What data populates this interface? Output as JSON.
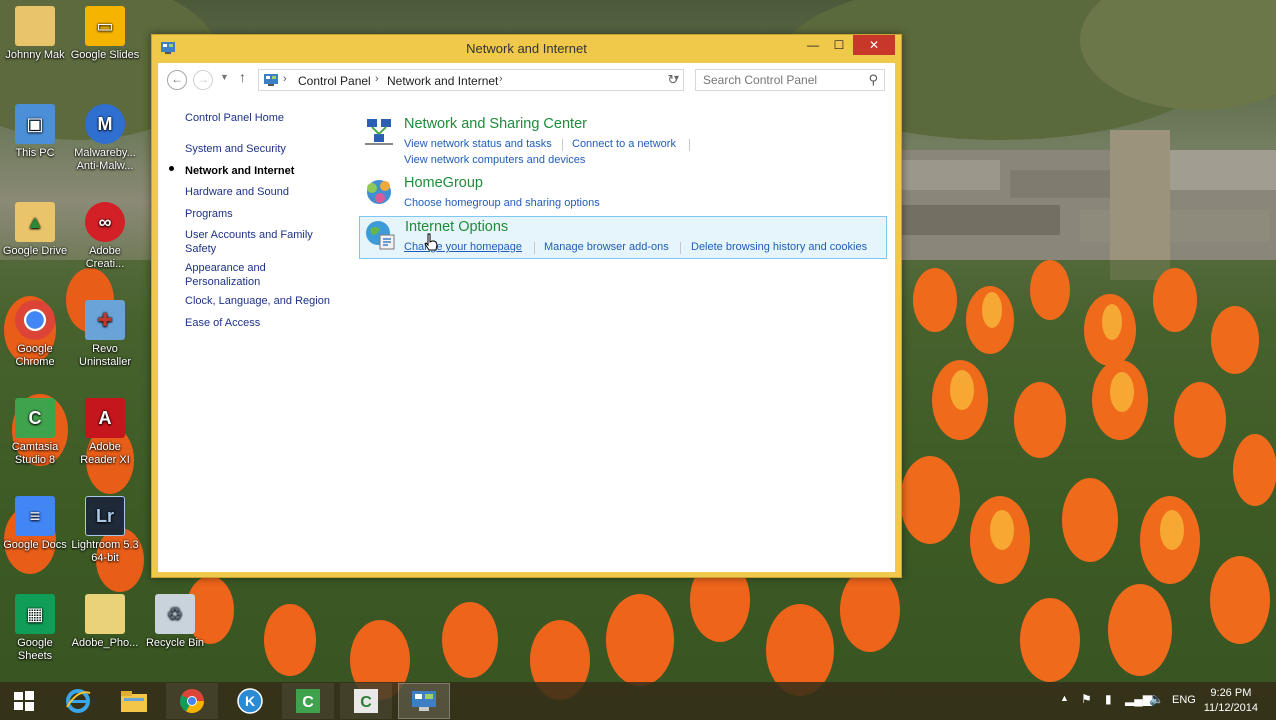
{
  "desktop": {
    "icons": [
      {
        "label": "Johnny Mak"
      },
      {
        "label": "Google Slides"
      },
      {
        "label": "This PC"
      },
      {
        "label": "Malwareby... Anti-Malw..."
      },
      {
        "label": "Google Drive"
      },
      {
        "label": "Adobe Creati..."
      },
      {
        "label": "Google Chrome"
      },
      {
        "label": "Revo Uninstaller"
      },
      {
        "label": "Camtasia Studio 8"
      },
      {
        "label": "Adobe Reader XI"
      },
      {
        "label": "Google Docs"
      },
      {
        "label": "Lightroom 5.3 64-bit"
      },
      {
        "label": "Google Sheets"
      },
      {
        "label": "Adobe_Pho..."
      },
      {
        "label": "Recycle Bin"
      }
    ]
  },
  "window": {
    "title": "Network and Internet",
    "buttons": {
      "minimize": "—",
      "maximize": "☐",
      "close": "✕"
    }
  },
  "address_bar": {
    "breadcrumbs": [
      "Control Panel",
      "Network and Internet"
    ],
    "search_placeholder": "Search Control Panel"
  },
  "sidebar": {
    "items": [
      {
        "label": "Control Panel Home"
      },
      {
        "label": "System and Security"
      },
      {
        "label": "Network and Internet",
        "current": true
      },
      {
        "label": "Hardware and Sound"
      },
      {
        "label": "Programs"
      },
      {
        "label": "User Accounts and Family Safety"
      },
      {
        "label": "Appearance and Personalization"
      },
      {
        "label": "Clock, Language, and Region"
      },
      {
        "label": "Ease of Access"
      }
    ]
  },
  "categories": [
    {
      "title": "Network and Sharing Center",
      "icon": "network-sharing-icon",
      "links": [
        "View network status and tasks",
        "Connect to a network",
        "View network computers and devices"
      ]
    },
    {
      "title": "HomeGroup",
      "icon": "homegroup-icon",
      "links": [
        "Choose homegroup and sharing options"
      ]
    },
    {
      "title": "Internet Options",
      "icon": "internet-options-icon",
      "links": [
        "Change your homepage",
        "Manage browser add-ons",
        "Delete browsing history and cookies"
      ]
    }
  ],
  "taskbar": {
    "tray": {
      "language": "ENG",
      "time": "9:26 PM",
      "date": "11/12/2014"
    }
  },
  "colors": {
    "link": "#1f5eb8",
    "category_title": "#1e8c3a",
    "window_frame": "#f0c84a",
    "close_button": "#c7372a"
  }
}
